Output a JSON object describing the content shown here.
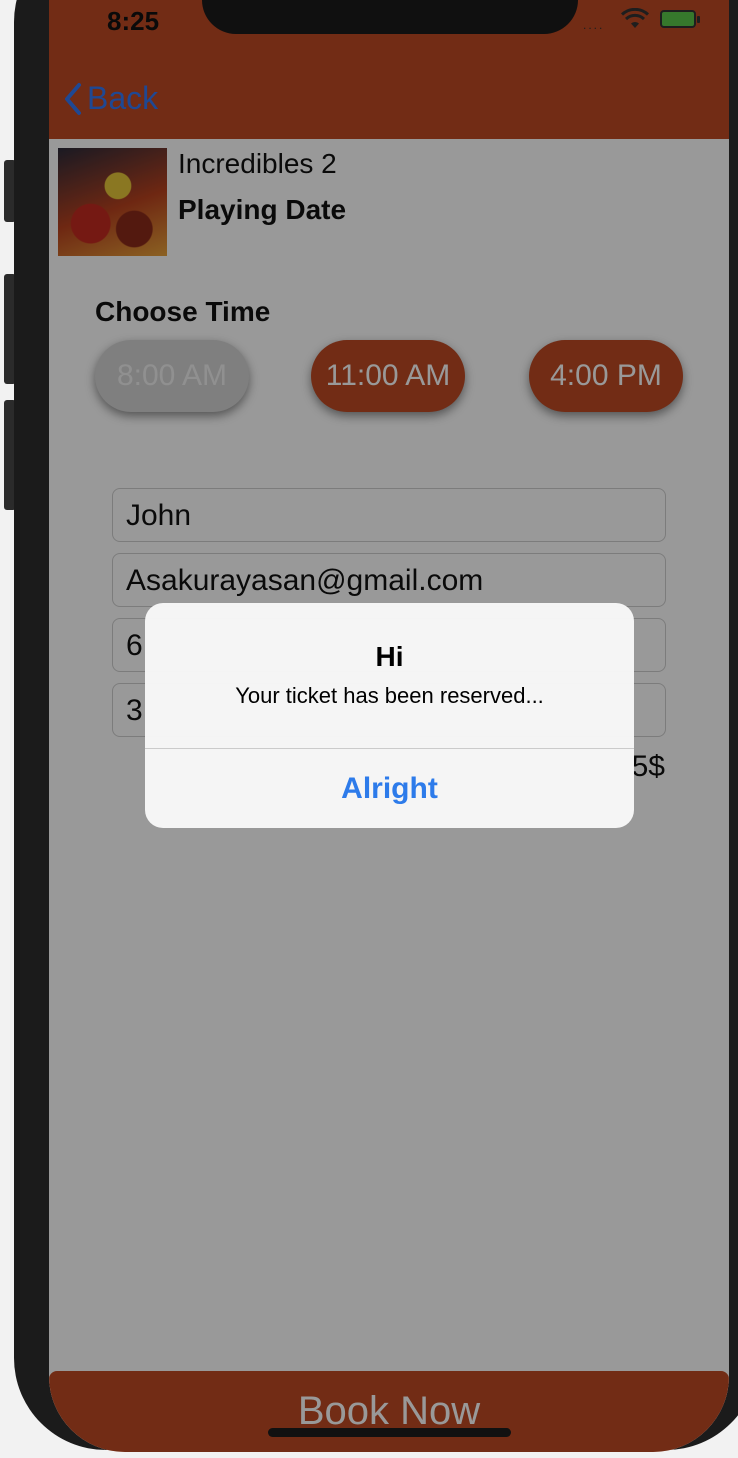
{
  "status_bar": {
    "time": "8:25",
    "signal": "....",
    "wifi_icon": "wifi-icon",
    "battery_icon": "battery-charging-icon"
  },
  "nav": {
    "back_label": "Back",
    "back_icon": "chevron-left-icon"
  },
  "movie": {
    "title": "Incredibles 2",
    "date_label": "Playing Date"
  },
  "time_section": {
    "label": "Choose Time",
    "options": [
      {
        "label": "8:00 AM",
        "state": "disabled"
      },
      {
        "label": "11:00 AM",
        "state": "available"
      },
      {
        "label": "4:00 PM",
        "state": "available"
      }
    ]
  },
  "form": {
    "name": "John",
    "email": "Asakurayasan@gmail.com",
    "field3_visible": "6",
    "field4_visible": "3"
  },
  "price_visible": "5$",
  "book_button": {
    "label": "Book Now"
  },
  "alert": {
    "title": "Hi",
    "message": "Your ticket has been reserved...",
    "action": "Alright"
  },
  "colors": {
    "brand": "#be4a23",
    "link": "#3478f6",
    "alert_action": "#2d7bea"
  }
}
